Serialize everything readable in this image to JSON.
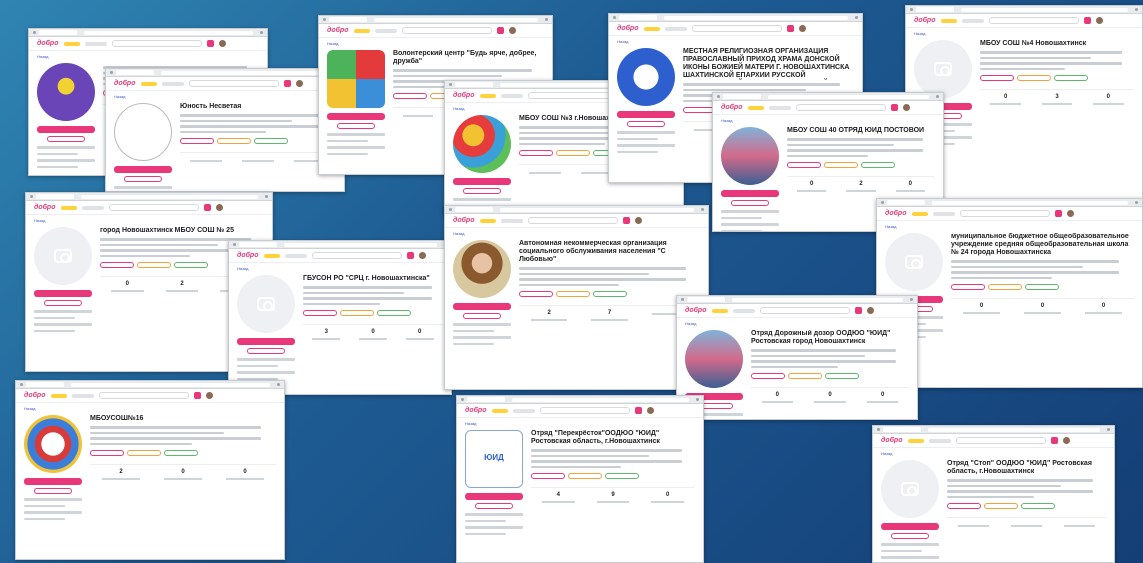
{
  "site": {
    "logo_part1": "добро",
    "logo_part2": "",
    "back_label": "Назад"
  },
  "cards": [
    {
      "id": "s1",
      "title": "",
      "logo": "purple",
      "stats": [
        "",
        "",
        ""
      ]
    },
    {
      "id": "s2",
      "title": "Юность Несветая",
      "logo": "sketch",
      "stats": [
        "",
        "",
        ""
      ]
    },
    {
      "id": "s3",
      "title": "Волонтерский центр \"Будь ярче, добрее, дружба\"",
      "logo": "puzzle",
      "stats": [
        "",
        "",
        ""
      ]
    },
    {
      "id": "s4",
      "title": "МБОУ СОШ №3 г.Новошахтинск",
      "logo": "heart",
      "stats": [
        "",
        "",
        ""
      ]
    },
    {
      "id": "s5",
      "title": "МЕСТНАЯ РЕЛИГИОЗНАЯ ОРГАНИЗАЦИЯ ПРАВОСЛАВНЫЙ ПРИХОД ХРАМА ДОНСКОЙ ИКОНЫ БОЖИЕЙ МАТЕРИ Г. НОВОШАХТИНСКА ШАХТИНСКОЙ ЕПАРХИИ РУССКОЙ ПРАВОСЛАВНОЙ ЦЕРКВИ (МОСКОВСКИЙ ПАТРИАРХАТ)",
      "logo": "blue-c",
      "stats": [
        "",
        "",
        ""
      ]
    },
    {
      "id": "s6",
      "title": "МБОУ СОШ №4 Новошахтинск",
      "logo": "camera",
      "stats": [
        "0",
        "3",
        "0"
      ]
    },
    {
      "id": "s7",
      "title": "МБОУ СОШ 40 ОТРЯД ЮИД ПОСТОВОЙ",
      "logo": "group-photo",
      "stats": [
        "0",
        "2",
        "0"
      ]
    },
    {
      "id": "s8",
      "title": "город Новошахтинск МБОУ СОШ № 25",
      "logo": "camera",
      "stats": [
        "0",
        "2",
        "0"
      ]
    },
    {
      "id": "s9",
      "title": "ГБУСОН РО \"СРЦ г. Новошахтинска\"",
      "logo": "camera",
      "stats": [
        "3",
        "0",
        "0"
      ]
    },
    {
      "id": "s10",
      "title": "Автономная некоммерческая организация социального обслуживания населения \"С Любовью\"",
      "logo": "woman",
      "stats": [
        "2",
        "7",
        ""
      ]
    },
    {
      "id": "s11",
      "title": "Отряд Дорожный дозор ООДЮО \"ЮИД\" Ростовская город Новошахтинск",
      "logo": "group-photo",
      "stats": [
        "0",
        "0",
        "0"
      ]
    },
    {
      "id": "s12",
      "title": "муниципальное бюджетное общеобразовательное учреждение средняя общеобразовательная школа № 24 города Новошахтинска",
      "logo": "camera",
      "stats": [
        "0",
        "0",
        "0"
      ]
    },
    {
      "id": "s13",
      "title": "МБОУСОШ№16",
      "logo": "yuid",
      "stats": [
        "2",
        "0",
        "0"
      ]
    },
    {
      "id": "s14",
      "title": "Отряд \"Перекрёсток\"ООДЮО \"ЮИД\" Ростовская область, г.Новошахтинск",
      "logo": "yuid2",
      "stats": [
        "4",
        "9",
        "0"
      ]
    },
    {
      "id": "s15",
      "title": "Отряд \"Стоп\" ООДЮО \"ЮИД\" Ростовская область, г.Новошахтинск",
      "logo": "camera",
      "stats": [
        "",
        "",
        ""
      ]
    }
  ]
}
